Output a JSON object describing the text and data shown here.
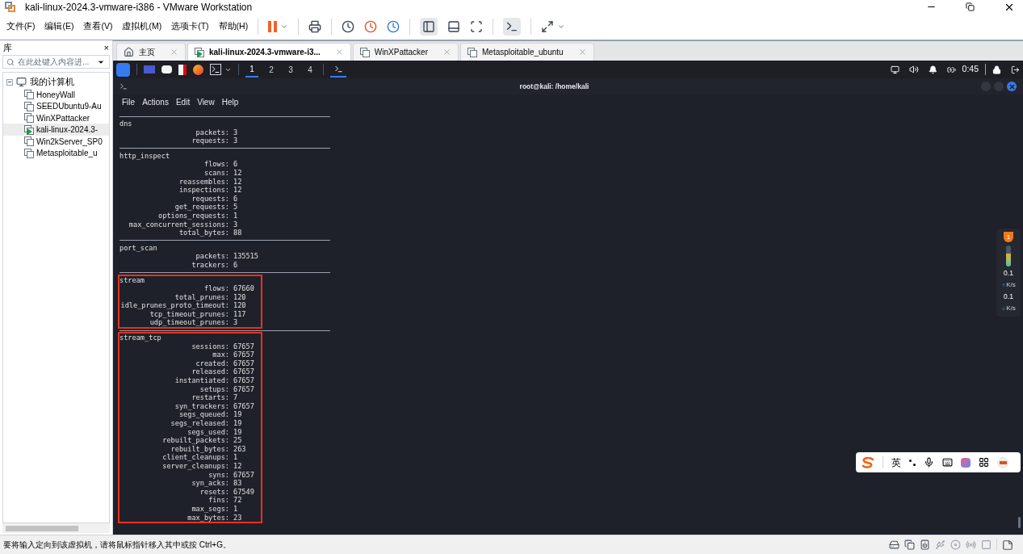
{
  "window": {
    "title": "kali-linux-2024.3-vmware-i386 - VMware Workstation"
  },
  "menu": [
    "文件(F)",
    "编辑(E)",
    "查看(V)",
    "虚拟机(M)",
    "选项卡(T)",
    "帮助(H)"
  ],
  "library": {
    "title": "库",
    "close": "×",
    "search": {
      "placeholder": "在此处键入内容进..."
    },
    "tree": {
      "label": "我的计算机",
      "expanded": true,
      "children": [
        {
          "label": "HoneyWall",
          "running": false
        },
        {
          "label": "SEEDUbuntu9-Au",
          "running": false
        },
        {
          "label": "WinXPattacker",
          "running": false
        },
        {
          "label": "kali-linux-2024.3-",
          "running": true
        },
        {
          "label": "Win2kServer_SP0",
          "running": false
        },
        {
          "label": "Metasploitable_u",
          "running": false
        }
      ]
    }
  },
  "tabs": [
    {
      "label": "主页",
      "kind": "home",
      "selected": false
    },
    {
      "label": "kali-linux-2024.3-vmware-i3...",
      "kind": "vm-running",
      "selected": true
    },
    {
      "label": "WinXPattacker",
      "kind": "vm",
      "selected": false
    },
    {
      "label": "Metasploitable_ubuntu",
      "kind": "vm",
      "selected": false
    }
  ],
  "kali_panel": {
    "workspaces": [
      {
        "label": "1",
        "selected": true
      },
      {
        "label": "2",
        "selected": false
      },
      {
        "label": "3",
        "selected": false
      },
      {
        "label": "4",
        "selected": false
      }
    ],
    "time": "0:45"
  },
  "terminal": {
    "title": "root@kali: /home/kali",
    "menu": [
      "File",
      "Actions",
      "Edit",
      "View",
      "Help"
    ],
    "sections": [
      {
        "name": "dns",
        "highlighted": false,
        "stats": [
          {
            "key": "packets:",
            "value": "3"
          },
          {
            "key": "requests:",
            "value": "3"
          }
        ]
      },
      {
        "name": "http_inspect",
        "highlighted": false,
        "stats": [
          {
            "key": "flows:",
            "value": "6"
          },
          {
            "key": "scans:",
            "value": "12"
          },
          {
            "key": "reassembles:",
            "value": "12"
          },
          {
            "key": "inspections:",
            "value": "12"
          },
          {
            "key": "requests:",
            "value": "6"
          },
          {
            "key": "get_requests:",
            "value": "5"
          },
          {
            "key": "options_requests:",
            "value": "1"
          },
          {
            "key": "max_concurrent_sessions:",
            "value": "3"
          },
          {
            "key": "total_bytes:",
            "value": "88"
          }
        ]
      },
      {
        "name": "port_scan",
        "highlighted": false,
        "stats": [
          {
            "key": "packets:",
            "value": "135515"
          },
          {
            "key": "trackers:",
            "value": "6"
          }
        ]
      },
      {
        "name": "stream",
        "highlighted": true,
        "stats": [
          {
            "key": "flows:",
            "value": "67660"
          },
          {
            "key": "total_prunes:",
            "value": "120"
          },
          {
            "key": "idle_prunes_proto_timeout:",
            "value": "120"
          },
          {
            "key": "tcp_timeout_prunes:",
            "value": "117"
          },
          {
            "key": "udp_timeout_prunes:",
            "value": "3"
          }
        ]
      },
      {
        "name": "stream_tcp",
        "highlighted": true,
        "stats": [
          {
            "key": "sessions:",
            "value": "67657"
          },
          {
            "key": "max:",
            "value": "67657"
          },
          {
            "key": "created:",
            "value": "67657"
          },
          {
            "key": "released:",
            "value": "67657"
          },
          {
            "key": "instantiated:",
            "value": "67657"
          },
          {
            "key": "setups:",
            "value": "67657"
          },
          {
            "key": "restarts:",
            "value": "7"
          },
          {
            "key": "syn_trackers:",
            "value": "67657"
          },
          {
            "key": "segs_queued:",
            "value": "19"
          },
          {
            "key": "segs_released:",
            "value": "19"
          },
          {
            "key": "segs_used:",
            "value": "19"
          },
          {
            "key": "rebuilt_packets:",
            "value": "25"
          },
          {
            "key": "rebuilt_bytes:",
            "value": "263"
          },
          {
            "key": "client_cleanups:",
            "value": "1"
          },
          {
            "key": "server_cleanups:",
            "value": "12"
          },
          {
            "key": "syns:",
            "value": "67657"
          },
          {
            "key": "syn_acks:",
            "value": "83"
          },
          {
            "key": "resets:",
            "value": "67549"
          },
          {
            "key": "fins:",
            "value": "72"
          },
          {
            "key": "max_segs:",
            "value": "1"
          },
          {
            "key": "max_bytes:",
            "value": "23"
          }
        ]
      }
    ]
  },
  "net_widget": {
    "badge": "1",
    "level": 0.6,
    "up": {
      "value": "0.1",
      "unit": "K/s"
    },
    "down": {
      "value": "0.1",
      "unit": "K/s"
    }
  },
  "ime_toolbar": {
    "mode": "英"
  },
  "status_bar": {
    "message": "要将输入定向到该虚拟机，请将鼠标指针移入其中或按 Ctrl+G。"
  }
}
